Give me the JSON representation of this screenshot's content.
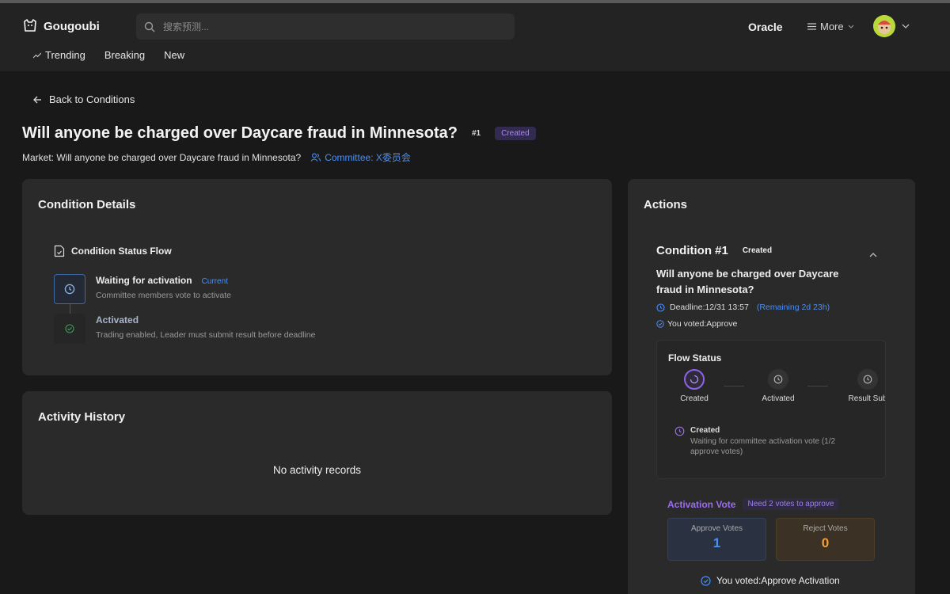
{
  "header": {
    "logo_text": "Gougoubi",
    "search_placeholder": "搜索预测...",
    "oracle": "Oracle",
    "more": "More",
    "nav": [
      "Trending",
      "Breaking",
      "New"
    ]
  },
  "page": {
    "back": "Back to Conditions",
    "title": "Will anyone be charged over Daycare fraud in Minnesota?",
    "number": "#1",
    "status_badge": "Created",
    "market": "Market: Will anyone be charged over Daycare fraud in Minnesota?",
    "committee": "Committee: X委员会"
  },
  "details": {
    "title": "Condition Details",
    "flow_heading": "Condition Status Flow",
    "steps": [
      {
        "title": "Waiting for activation",
        "tag": "Current",
        "desc": "Committee members vote to activate"
      },
      {
        "title": "Activated",
        "desc": "Trading enabled, Leader must submit result before deadline"
      }
    ]
  },
  "activity": {
    "title": "Activity History",
    "empty": "No activity records"
  },
  "actions": {
    "title": "Actions",
    "condition_title": "Condition #1",
    "condition_status": "Created",
    "question": "Will anyone be charged over Daycare fraud in Minnesota?",
    "deadline": "Deadline:12/31 13:57",
    "remaining": "(Remaining 2d 23h)",
    "voted": "You voted:Approve",
    "flow": {
      "title": "Flow Status",
      "steps": [
        "Created",
        "Activated",
        "Result Sub"
      ],
      "detail_title": "Created",
      "detail_desc": "Waiting for committee activation vote (1/2 approve votes)"
    },
    "vote": {
      "title": "Activation Vote",
      "need": "Need 2 votes to approve",
      "approve_label": "Approve Votes",
      "approve_count": "1",
      "reject_label": "Reject Votes",
      "reject_count": "0",
      "you_voted": "You voted:Approve Activation"
    }
  },
  "colors": {
    "accent_blue": "#4d8ef0",
    "accent_purple": "#9a6df0",
    "accent_orange": "#f0a040",
    "background": "#191919",
    "card": "#2a2a2a"
  }
}
